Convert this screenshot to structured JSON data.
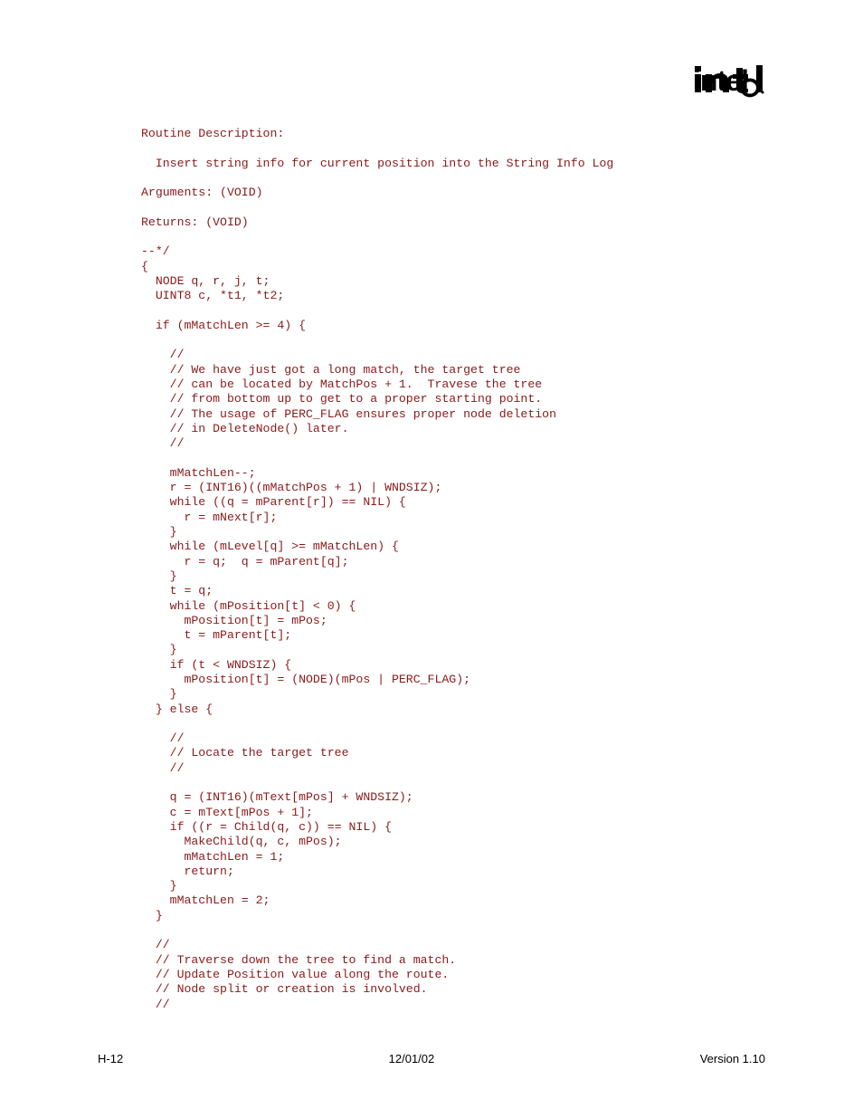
{
  "logo_text": "intel",
  "code": "Routine Description:\n\n  Insert string info for current position into the String Info Log\n\nArguments: (VOID)\n\nReturns: (VOID)\n\n--*/\n{\n  NODE q, r, j, t;\n  UINT8 c, *t1, *t2;\n\n  if (mMatchLen >= 4) {\n\n    //\n    // We have just got a long match, the target tree\n    // can be located by MatchPos + 1.  Travese the tree\n    // from bottom up to get to a proper starting point.\n    // The usage of PERC_FLAG ensures proper node deletion\n    // in DeleteNode() later.\n    //\n\n    mMatchLen--;\n    r = (INT16)((mMatchPos + 1) | WNDSIZ);\n    while ((q = mParent[r]) == NIL) {\n      r = mNext[r];\n    }\n    while (mLevel[q] >= mMatchLen) {\n      r = q;  q = mParent[q];\n    }\n    t = q;\n    while (mPosition[t] < 0) {\n      mPosition[t] = mPos;\n      t = mParent[t];\n    }\n    if (t < WNDSIZ) {\n      mPosition[t] = (NODE)(mPos | PERC_FLAG);\n    }\n  } else {\n\n    //\n    // Locate the target tree\n    //\n\n    q = (INT16)(mText[mPos] + WNDSIZ);\n    c = mText[mPos + 1];\n    if ((r = Child(q, c)) == NIL) {\n      MakeChild(q, c, mPos);\n      mMatchLen = 1;\n      return;\n    }\n    mMatchLen = 2;\n  }\n\n  //\n  // Traverse down the tree to find a match.\n  // Update Position value along the route.\n  // Node split or creation is involved.\n  //",
  "footer": {
    "left": "H-12",
    "center": "12/01/02",
    "right": "Version 1.10"
  }
}
